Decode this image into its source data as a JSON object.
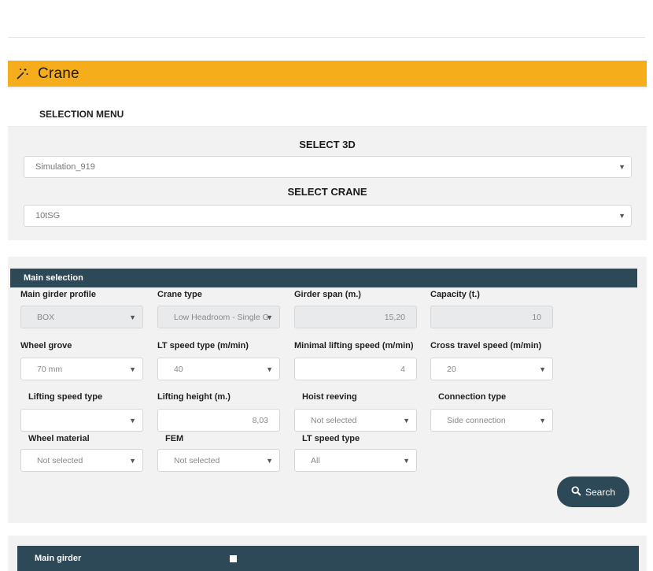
{
  "header": {
    "title": "Crane",
    "icon": "magic-wand-icon",
    "color": "#f5ad1c"
  },
  "selection_menu": {
    "label": "SELECTION MENU",
    "select_3d": {
      "heading": "SELECT 3D",
      "value": "Simulation_919"
    },
    "select_crane": {
      "heading": "SELECT CRANE",
      "value": "10tSG"
    }
  },
  "main_selection": {
    "title": "Main selection",
    "fields": {
      "main_girder_profile": {
        "label": "Main girder profile",
        "value": "BOX"
      },
      "crane_type": {
        "label": "Crane type",
        "value": "Low Headroom - Single G"
      },
      "girder_span": {
        "label": "Girder span (m.)",
        "value": "15,20"
      },
      "capacity": {
        "label": "Capacity (t.)",
        "value": "10"
      },
      "wheel_grove": {
        "label": "Wheel grove",
        "value": "70 mm"
      },
      "lt_speed_type_mmin": {
        "label": "LT speed type (m/min)",
        "value": "40"
      },
      "minimal_lifting_speed": {
        "label": "Minimal lifting speed (m/min)",
        "value": "4"
      },
      "cross_travel_speed": {
        "label": "Cross travel speed (m/min)",
        "value": "20"
      },
      "lifting_speed_type": {
        "label": "Lifting speed type",
        "value": ""
      },
      "lifting_height": {
        "label": "Lifting height (m.)",
        "value": "8,03"
      },
      "hoist_reeving": {
        "label": "Hoist reeving",
        "value": "Not selected"
      },
      "connection_type": {
        "label": "Connection type",
        "value": "Side connection"
      },
      "wheel_material": {
        "label": "Wheel material",
        "value": "Not selected"
      },
      "fem": {
        "label": "FEM",
        "value": "Not selected"
      },
      "lt_speed_type": {
        "label": "LT speed type",
        "value": "All"
      }
    },
    "search_button": {
      "label": "Search",
      "icon": "search-icon"
    }
  },
  "main_girder": {
    "title": "Main girder"
  },
  "colors": {
    "dark_bar": "#2d4856",
    "panel_bg": "#f2f2f2"
  }
}
